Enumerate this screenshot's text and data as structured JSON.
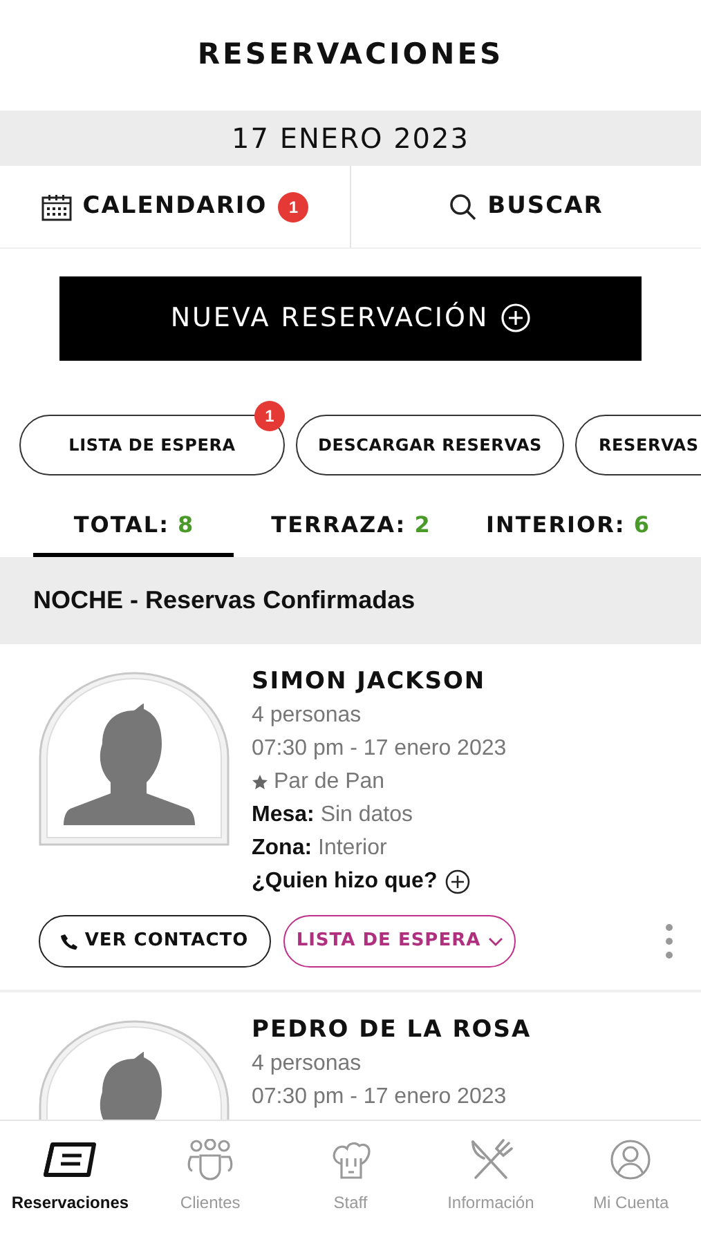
{
  "header": {
    "title": "RESERVACIONES"
  },
  "date": "17 ENERO 2023",
  "actions": [
    {
      "kind": "calendar",
      "label": "CALENDARIO",
      "badge": "1"
    },
    {
      "kind": "search",
      "label": "BUSCAR"
    }
  ],
  "new_button": {
    "label": "NUEVA RESERVACIÓN"
  },
  "chips": [
    {
      "label": "LISTA DE ESPERA",
      "badge": "1"
    },
    {
      "label": "DESCARGAR RESERVAS"
    },
    {
      "label": "RESERVAS"
    }
  ],
  "tabs": [
    {
      "label": "TOTAL:",
      "count": "8",
      "selected": true
    },
    {
      "label": "TERRAZA:",
      "count": "2",
      "selected": false
    },
    {
      "label": "INTERIOR:",
      "count": "6",
      "selected": false
    }
  ],
  "section": "NOCHE - Reservas Confirmadas",
  "reservations": [
    {
      "name": "SIMON JACKSON",
      "people": "4 personas",
      "datetime": "07:30 pm - 17 enero 2023",
      "tag": "Par de Pan",
      "mesa_label": "Mesa:",
      "mesa": "Sin datos",
      "zona_label": "Zona:",
      "zona": "Interior",
      "who": "¿Quien hizo que?",
      "contact_button": "VER CONTACTO",
      "status_button": "LISTA DE ESPERA"
    },
    {
      "name": "PEDRO DE LA ROSA",
      "people": "4 personas",
      "datetime": "07:30 pm - 17 enero 2023"
    }
  ],
  "nav": [
    {
      "kind": "reservations",
      "label": "Reservaciones",
      "selected": true
    },
    {
      "kind": "clients",
      "label": "Clientes",
      "selected": false
    },
    {
      "kind": "staff",
      "label": "Staff",
      "selected": false
    },
    {
      "kind": "info",
      "label": "Información",
      "selected": false
    },
    {
      "kind": "account",
      "label": "Mi Cuenta",
      "selected": false
    }
  ]
}
